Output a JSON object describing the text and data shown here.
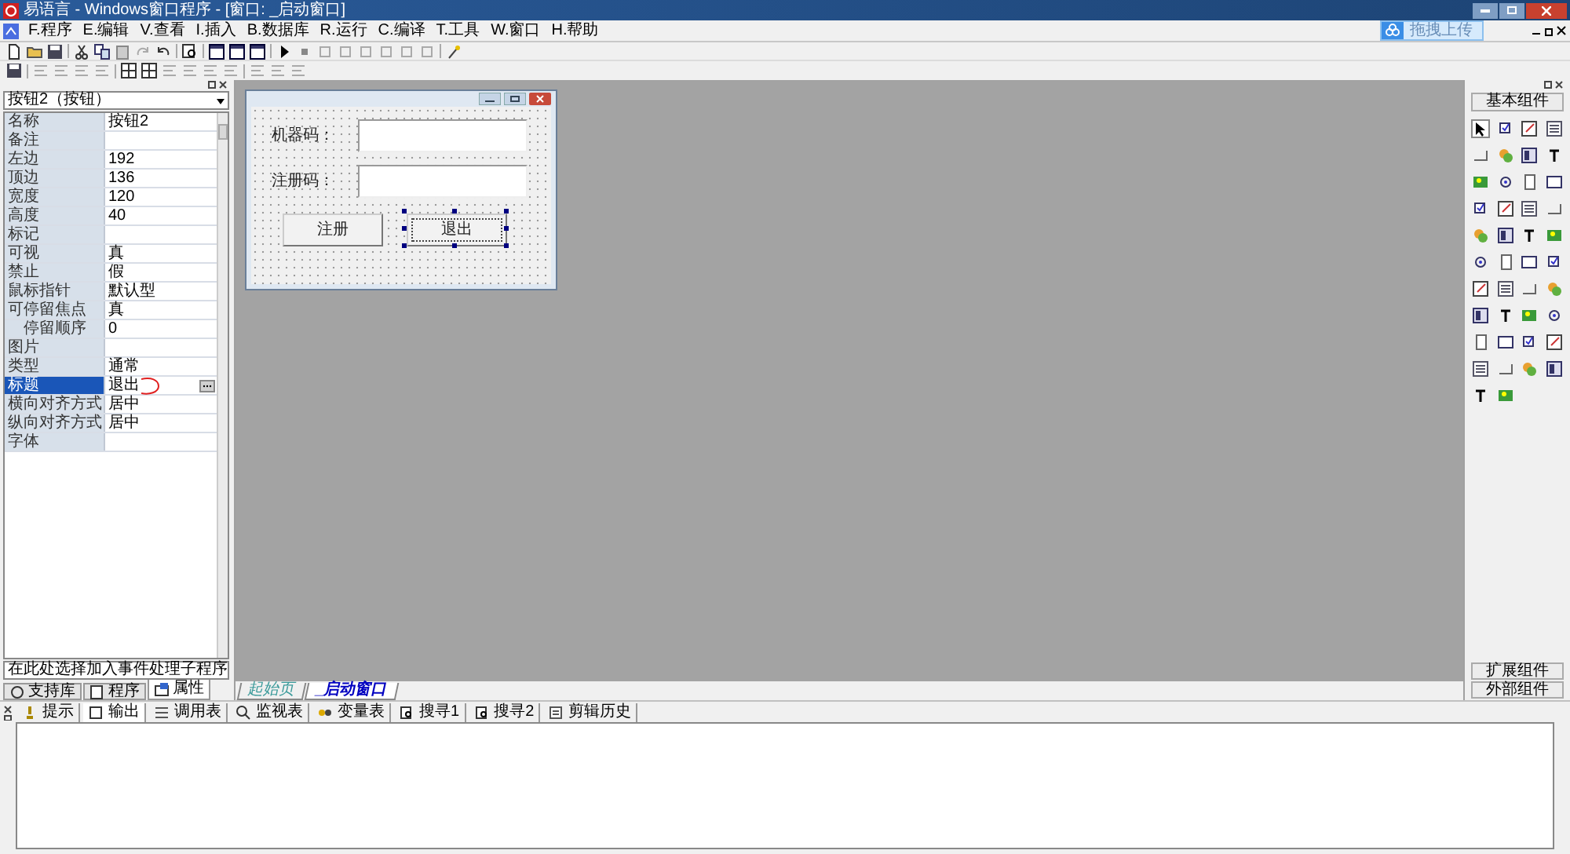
{
  "window": {
    "title": "易语言 - Windows窗口程序 - [窗口: _启动窗口]"
  },
  "menu": [
    "F.程序",
    "E.编辑",
    "V.查看",
    "I.插入",
    "B.数据库",
    "R.运行",
    "C.编译",
    "T.工具",
    "W.窗口",
    "H.帮助"
  ],
  "upload_button": "拖拽上传",
  "properties": {
    "object": "按钮2（按钮）",
    "rows": [
      {
        "name": "名称",
        "value": "按钮2",
        "selected": false
      },
      {
        "name": "备注",
        "selected": false
      },
      {
        "name": "左边",
        "value": "192",
        "selected": false
      },
      {
        "name": "顶边",
        "value": "136",
        "selected": false
      },
      {
        "name": "宽度",
        "value": "120",
        "selected": false
      },
      {
        "name": "高度",
        "value": "40",
        "selected": false
      },
      {
        "name": "标记",
        "selected": false
      },
      {
        "name": "可视",
        "value": "真",
        "selected": false
      },
      {
        "name": "禁止",
        "value": "假",
        "selected": false
      },
      {
        "name": "鼠标指针",
        "value": "默认型",
        "selected": false
      },
      {
        "name": "可停留焦点",
        "value": "真",
        "selected": false,
        "children": [
          {
            "name": "停留顺序",
            "value": "0",
            "selected": false
          }
        ]
      },
      {
        "name": "图片",
        "selected": false
      },
      {
        "name": "类型",
        "value": "通常",
        "selected": false
      },
      {
        "name": "标题",
        "value": "退出",
        "selected": true
      },
      {
        "name": "横向对齐方式",
        "value": "居中",
        "selected": false
      },
      {
        "name": "纵向对齐方式",
        "value": "居中",
        "selected": false
      },
      {
        "name": "字体",
        "selected": false
      }
    ]
  },
  "event_dropdown": "在此处选择加入事件处理子程序",
  "left_tabs": [
    {
      "label": "支持库",
      "selected": false
    },
    {
      "label": "程序",
      "selected": false
    },
    {
      "label": "属性",
      "selected": true
    }
  ],
  "designer": {
    "fields": [
      {
        "label": "机器码："
      },
      {
        "label": "注册码："
      }
    ],
    "buttons": [
      {
        "label": "注册",
        "selected": false
      },
      {
        "label": "退出",
        "selected": true
      }
    ]
  },
  "document_tabs": [
    {
      "label": "起始页",
      "selected": false
    },
    {
      "label": "_启动窗口",
      "selected": true
    }
  ],
  "toolbox": {
    "title": "基本组件",
    "footer": [
      "扩展组件",
      "外部组件"
    ]
  },
  "output_tabs": [
    {
      "label": "提示",
      "selected": false
    },
    {
      "label": "输出",
      "selected": true
    },
    {
      "label": "调用表",
      "selected": false
    },
    {
      "label": "监视表",
      "selected": false
    },
    {
      "label": "变量表",
      "selected": false
    },
    {
      "label": "搜寻1",
      "selected": false
    },
    {
      "label": "搜寻2",
      "selected": false
    },
    {
      "label": "剪辑历史",
      "selected": false
    }
  ]
}
